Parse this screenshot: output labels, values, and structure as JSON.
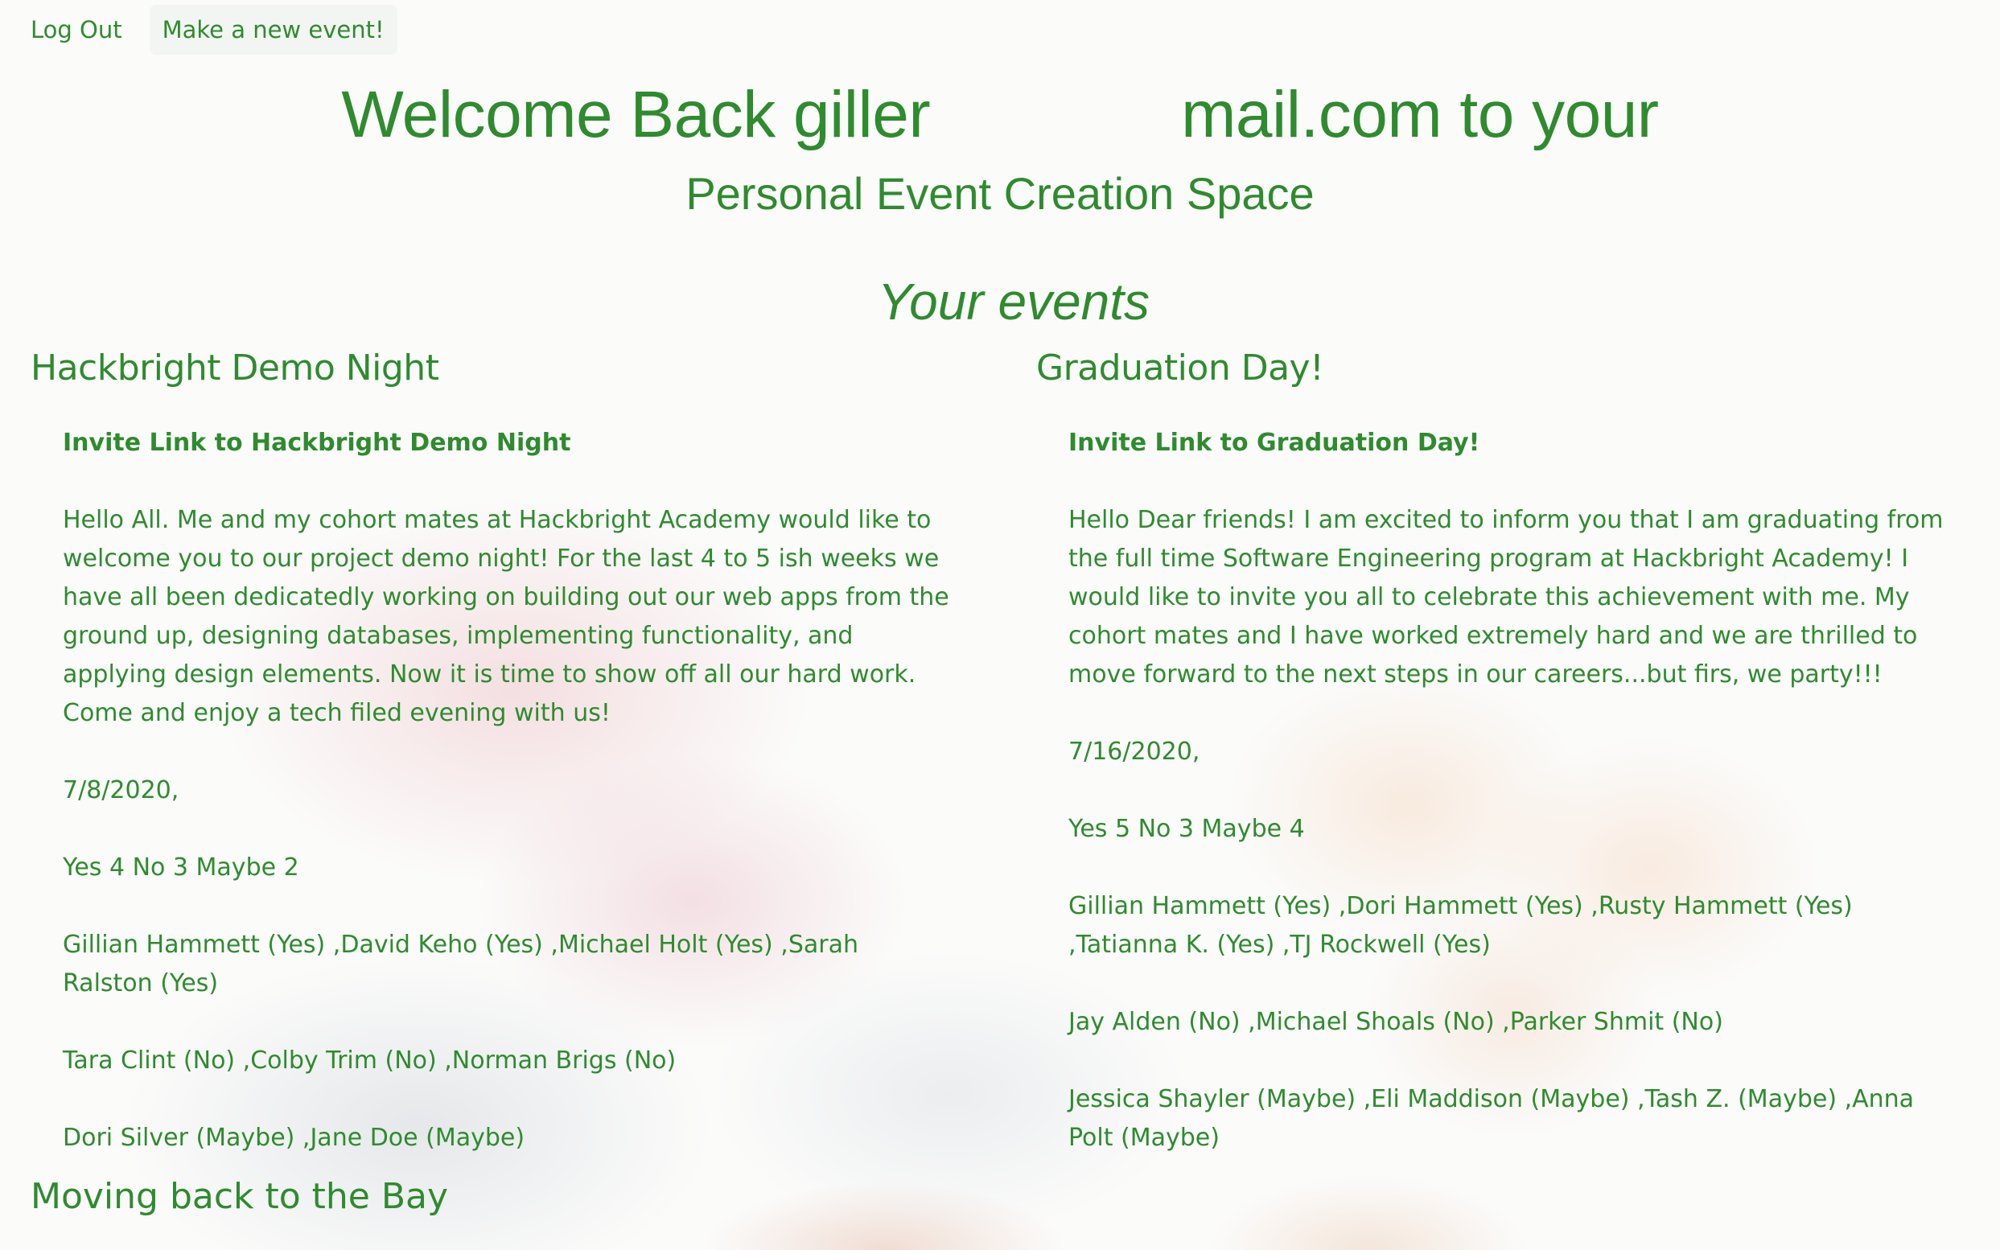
{
  "nav": {
    "logout_label": "Log Out",
    "new_event_label": "Make a new event!"
  },
  "header": {
    "welcome": "Welcome Back giller              mail.com to your",
    "subtitle": "Personal Event Creation Space",
    "section_title": "Your events"
  },
  "events": [
    {
      "title": "Hackbright Demo Night",
      "invite_link": "Invite Link to Hackbright Demo Night",
      "description": "Hello All. Me and my cohort mates at Hackbright Academy would like to welcome you to our project demo night! For the last 4 to 5 ish weeks we have all been dedicatedly working on building out our web apps from the ground up, designing databases, implementing functionality, and applying design elements. Now it is time to show off all our hard work. Come and enjoy a tech filed evening with us!",
      "date": "7/8/2020,",
      "rsvp_counts": "Yes 4 No 3 Maybe 2",
      "yes_list": "Gillian Hammett (Yes) ,David Keho (Yes) ,Michael Holt (Yes) ,Sarah Ralston (Yes)",
      "no_list": "Tara Clint (No) ,Colby Trim (No) ,Norman Brigs (No)",
      "maybe_list": "Dori Silver (Maybe) ,Jane Doe (Maybe)"
    },
    {
      "title": "Graduation Day!",
      "invite_link": "Invite Link to Graduation Day!",
      "description": "Hello Dear friends! I am excited to inform you that I am graduating from the full time Software Engineering program at Hackbright Academy! I would like to invite you all to celebrate this achievement with me. My cohort mates and I have worked extremely hard and we are thrilled to move forward to the next steps in our careers...but firs, we party!!!",
      "date": "7/16/2020,",
      "rsvp_counts": "Yes 5 No 3 Maybe 4",
      "yes_list": "Gillian Hammett (Yes) ,Dori Hammett (Yes) ,Rusty Hammett (Yes) ,Tatianna K. (Yes) ,TJ Rockwell (Yes)",
      "no_list": "Jay Alden (No) ,Michael Shoals (No) ,Parker Shmit (No)",
      "maybe_list": "Jessica Shayler (Maybe) ,Eli Maddison (Maybe) ,Tash Z. (Maybe) ,Anna Polt (Maybe)"
    },
    {
      "title": "Moving back to the Bay"
    }
  ],
  "colors": {
    "text_green": "#2e8b2e",
    "button_bg": "#f3f5f3"
  }
}
